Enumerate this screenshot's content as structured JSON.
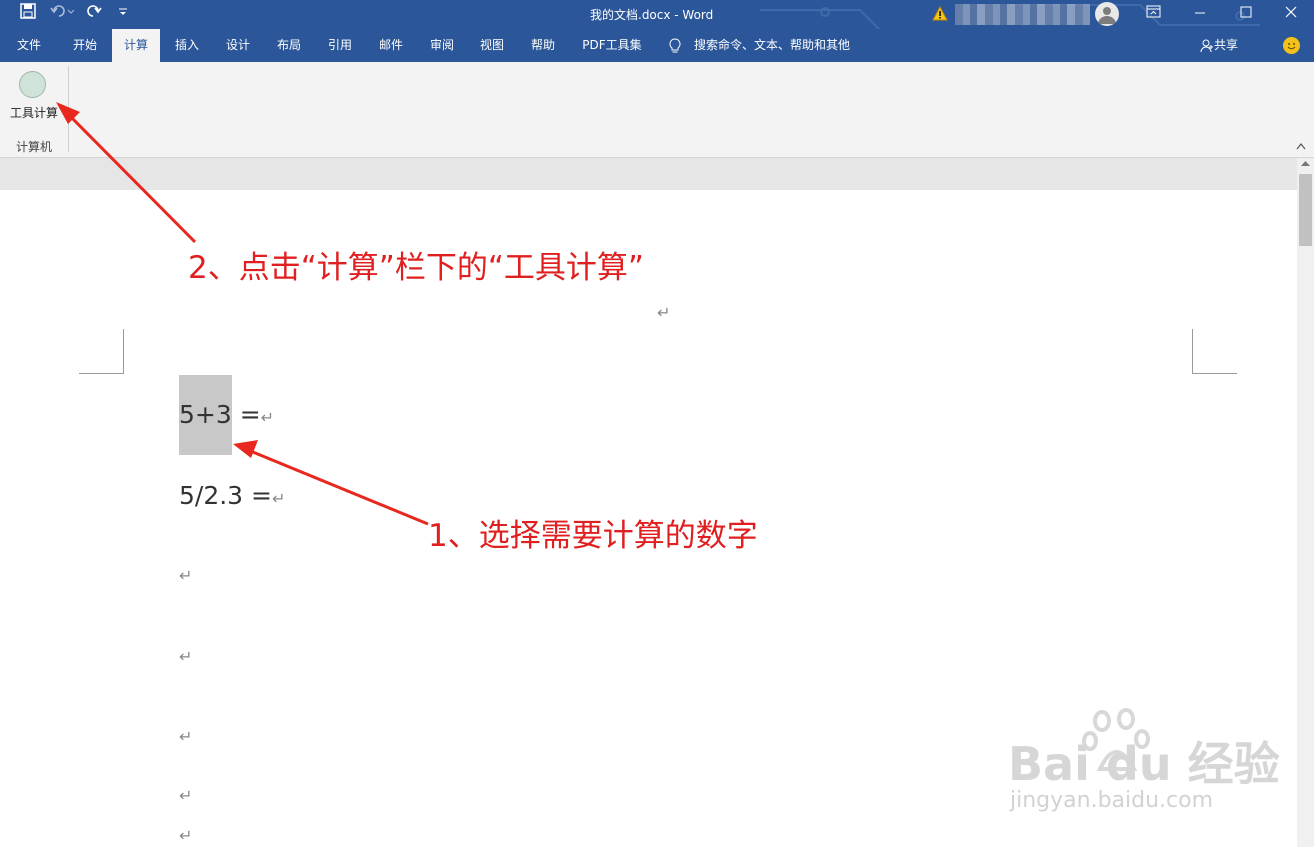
{
  "window": {
    "title": "我的文档.docx  -  Word",
    "accent_color": "#2b579a"
  },
  "quick_access": {
    "icons": [
      "save-icon",
      "undo-icon",
      "redo-icon",
      "customize-icon"
    ]
  },
  "tabs": [
    {
      "label": "文件"
    },
    {
      "label": "开始"
    },
    {
      "label": "计算",
      "active": true
    },
    {
      "label": "插入"
    },
    {
      "label": "设计"
    },
    {
      "label": "布局"
    },
    {
      "label": "引用"
    },
    {
      "label": "邮件"
    },
    {
      "label": "审阅"
    },
    {
      "label": "视图"
    },
    {
      "label": "帮助"
    },
    {
      "label": "PDF工具集"
    }
  ],
  "tell_me": "搜索命令、文本、帮助和其他",
  "share_label": "共享",
  "ribbon": {
    "button_label": "工具计算",
    "group_label": "计算机"
  },
  "document": {
    "line1": "5+3",
    "line1_suffix": " =",
    "line2": "5/2.3 =",
    "para_mark": "↵"
  },
  "annotations": {
    "step2": "2、点击“计算”栏下的“工具计算”",
    "step1": "1、选择需要计算的数字",
    "color": "#e02020"
  },
  "watermark": {
    "brand": "Bai du 经验",
    "url": "jingyan.baidu.com"
  }
}
